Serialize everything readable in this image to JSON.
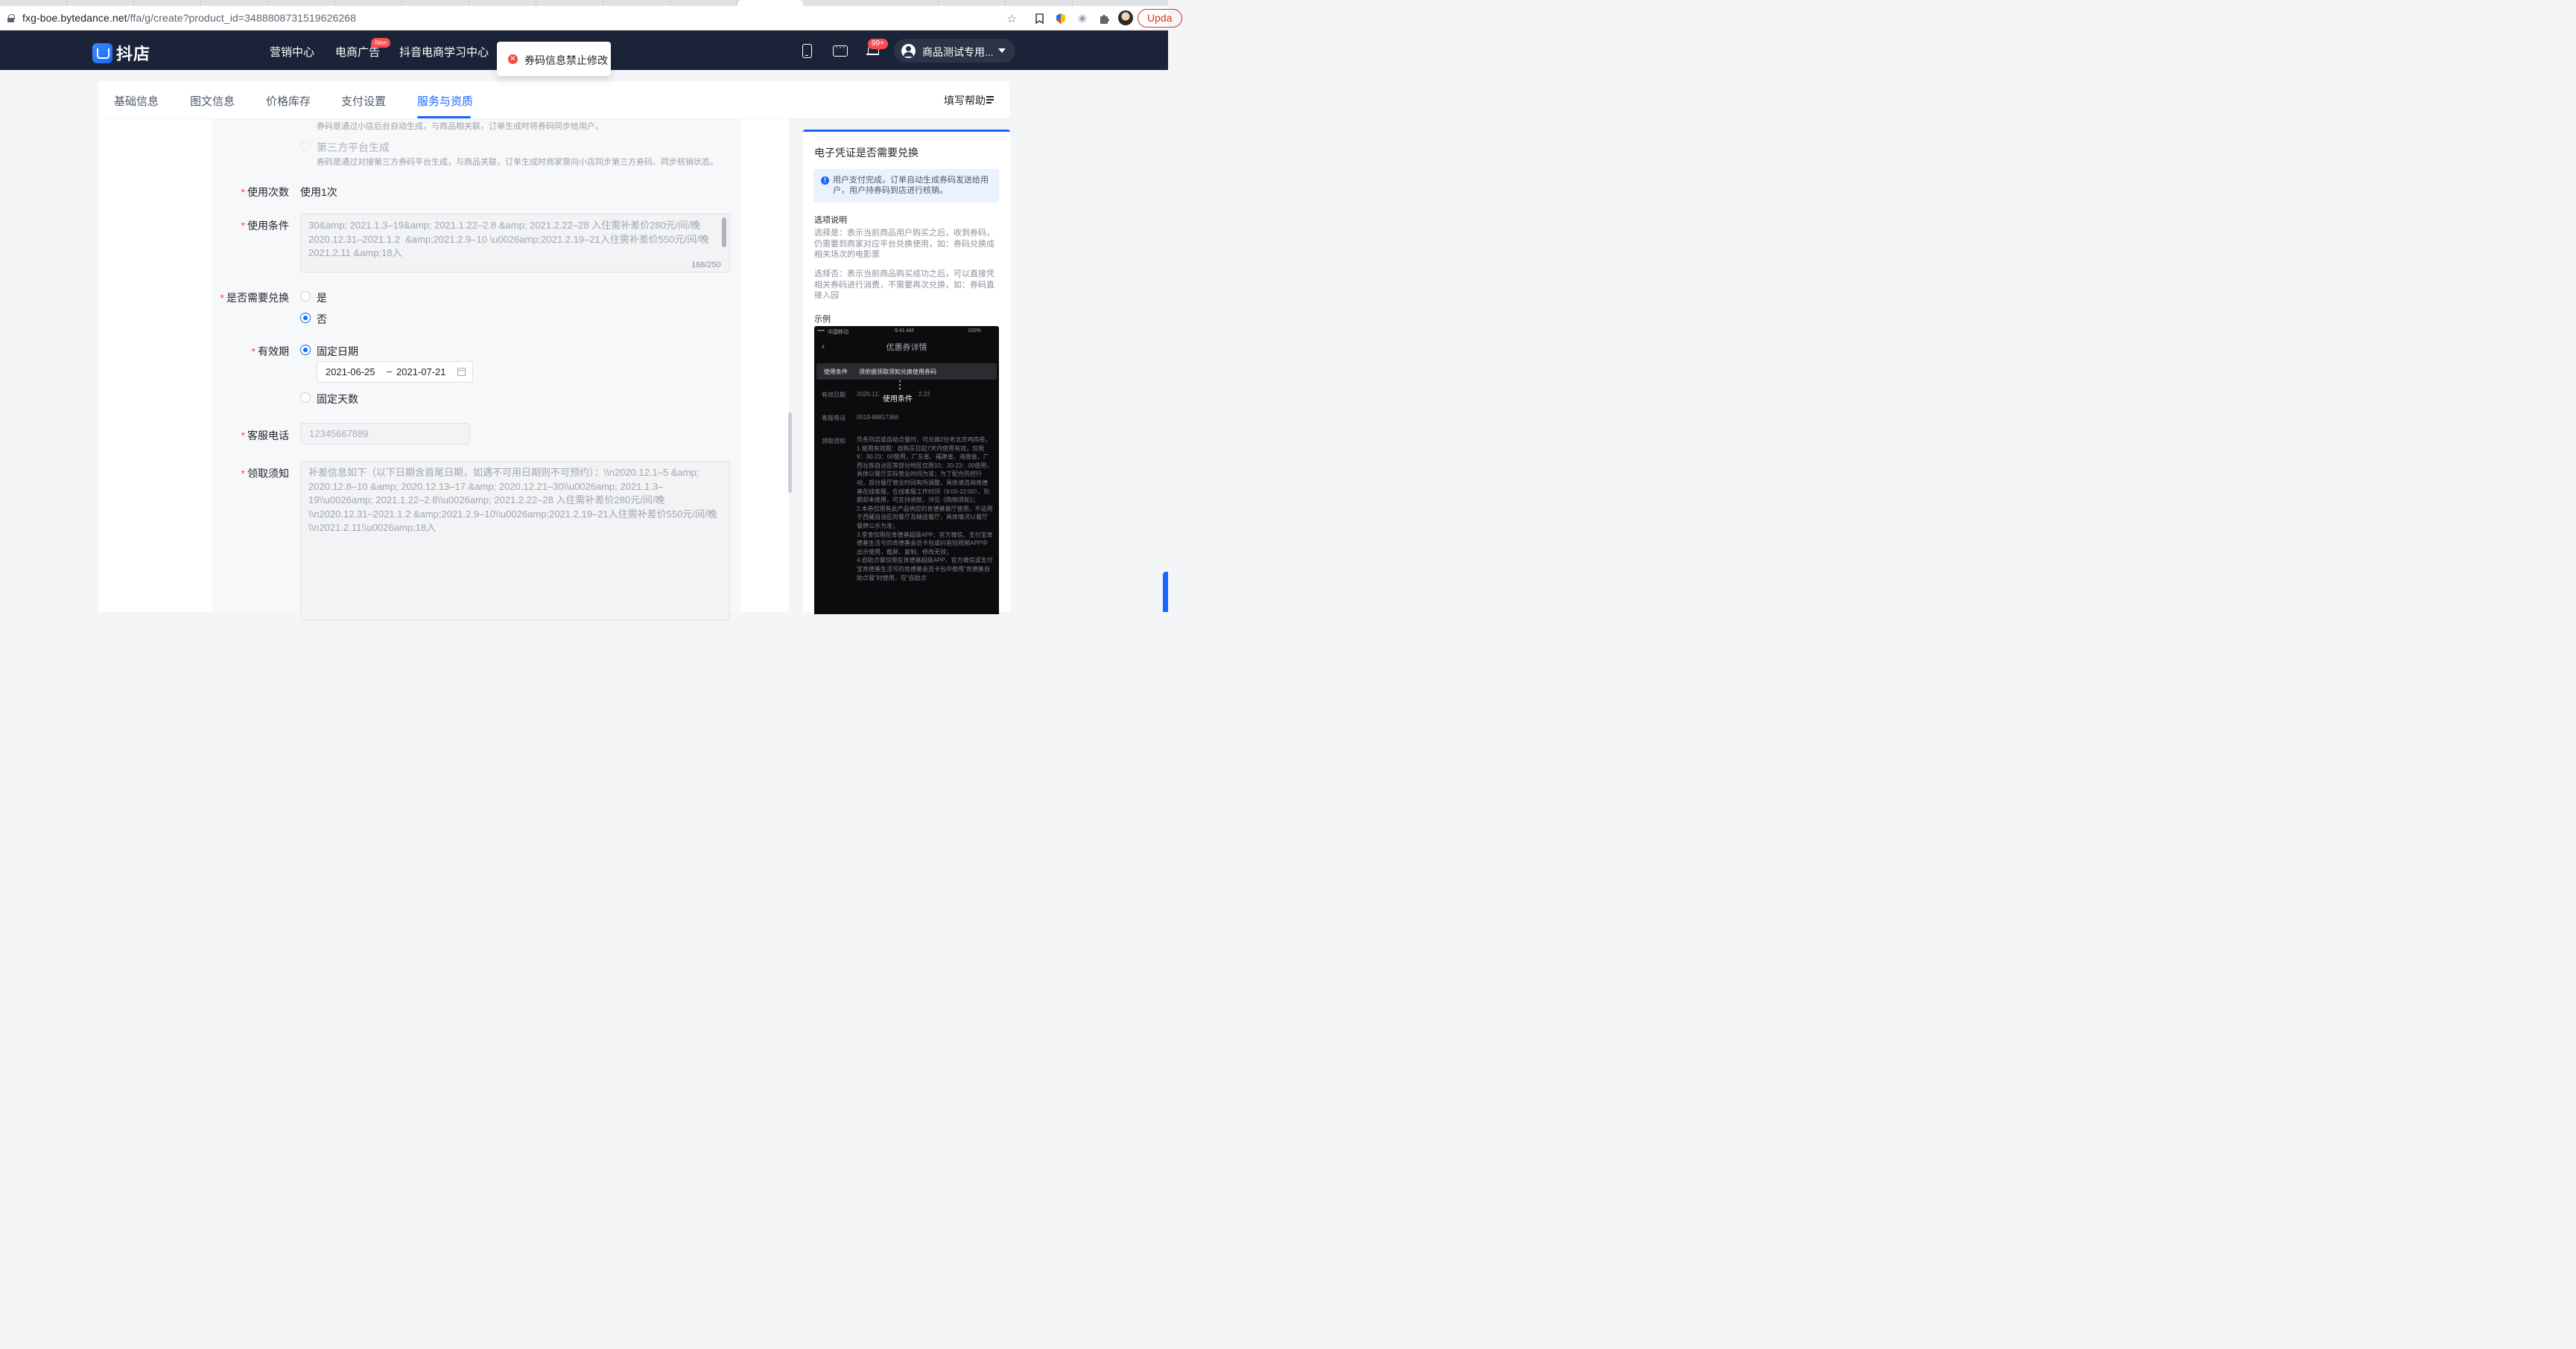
{
  "browser": {
    "url_host": "fxg-boe.bytedance.net",
    "url_path": "/ffa/g/create?product_id=3488808731519626268",
    "update_label": "Upda"
  },
  "topnav": {
    "logo_text": "抖店",
    "items": [
      "营销中心",
      "电商广告",
      "抖音电商学习中心"
    ],
    "new_badge": "New",
    "notification_count": "99+",
    "user_name": "商品测试专用..."
  },
  "toast": {
    "message": "券码信息禁止修改"
  },
  "tabs": {
    "items": [
      "基础信息",
      "图文信息",
      "价格库存",
      "支付设置",
      "服务与资质"
    ],
    "active_index": 4,
    "help_label": "填写帮助"
  },
  "form": {
    "top_hint": "券码是通过小店后台自动生成，与商品相关联，订单生成时将券码同步给用户。",
    "third_party_label": "第三方平台生成",
    "third_party_hint": "券码是通过对接第三方券码平台生成，与商品关联，订单生成时商家需向小店同步第三方券码、同步核销状态。",
    "usage_count_label": "使用次数",
    "usage_count_value": "使用1次",
    "usage_cond_label": "使用条件",
    "usage_cond_value": "30&amp; 2021.1.3–19&amp; 2021.1.22–2.8 &amp; 2021.2.22–28 入住需补差价280元/间/晚\n2020.12.31–2021.1.2  &amp;2021.2.9–10 \\u0026amp;2021.2.19–21入住需补差价550元/间/晚\n2021.2.11 &amp;18入",
    "usage_cond_counter": "168/250",
    "exchange_label": "是否需要兑换",
    "exchange_yes": "是",
    "exchange_no": "否",
    "validity_label": "有效期",
    "validity_fixed_date": "固定日期",
    "date_start": "2021-06-25",
    "date_sep": "–",
    "date_end": "2021-07-21",
    "validity_fixed_days": "固定天数",
    "phone_label": "客服电话",
    "phone_placeholder": "12345667889",
    "notice_label": "领取须知",
    "notice_value": "补差信息如下（以下日期含首尾日期，如遇不可用日期则不可预约）：\\\\n2020.12.1–5 &amp;\n2020.12.8–10 &amp; 2020.12.13–17 &amp; 2020.12.21–30\\\\u0026amp; 2021.1.3–\n19\\\\u0026amp; 2021.1.22–2.8\\\\u0026amp; 2021.2.22–28 入住需补差价280元/间/晚\n\\\\n2020.12.31–2021.1.2 &amp;2021.2.9–10\\\\u0026amp;2021.2.19–21入住需补差价550元/间/晚\n\\\\n2021.2.11\\\\u0026amp;18入"
  },
  "help_panel": {
    "title": "电子凭证是否需要兑换",
    "info": "用户支付完成，订单自动生成券码发送给用户，用户持券码到店进行核销。",
    "options_title": "选项说明",
    "option_yes": "选择是：表示当前商品用户购买之后，收到券码，仍需要到商家对应平台兑换使用，如：券码兑换成相关场次的电影票",
    "option_no": "选择否：表示当前商品购买成功之后，可以直接凭相关券码进行消费，不需要再次兑换，如：券码直接入园",
    "example_title": "示例",
    "phone": {
      "carrier": "中国移动",
      "time": "9:41 AM",
      "battery": "100%",
      "header": "优惠券详情",
      "row1_key": "使用条件",
      "row1_val": "须依据领取须知兑换使用券码",
      "row2_key": "有效日期",
      "row2_val": "2020.12.",
      "row2_val_tail": "2.22",
      "tooltip": "使用条件",
      "row3_key": "客服电话",
      "row3_val": "0519-88817366",
      "row4_key": "领取须知",
      "row4_val": "凭券到店或自助点餐时，可兑换2份老北京鸡肉卷。\n1.使用有效期：自购买日起7天内使用有效，仅限9：30-23：00使用，广东省、福建省、海南省、广西壮族自治区等部分地区仅限10：30-23：00使用，具体以餐厅实际营业时间为准；为了配合防控行动，部分餐厅营业时间有所调整，具体请咨询肯德基在线客服，在线客服工作时间（9:00-22:00），到期却未使用，可支持退款，详见《购物须知》；\n2.本券仅限有此产品供应的肯德基餐厅使用，不适用于西藏自治区的餐厅及精选餐厅，具体情况以餐厅餐牌公示为准；\n3.堂食仅限在肯德基超级APP、官方微信、支付宝肯德基生活号的肯德基会员卡包或抖音短视频APP中出示使用，截屏、复制、修改无效；\n4.自助点餐仅限在肯德基超级APP、官方微信或支付宝肯德基生活号的肯德基会员卡包中使用\"肯德基自助点餐\"时使用，在\"自助点"
    }
  }
}
